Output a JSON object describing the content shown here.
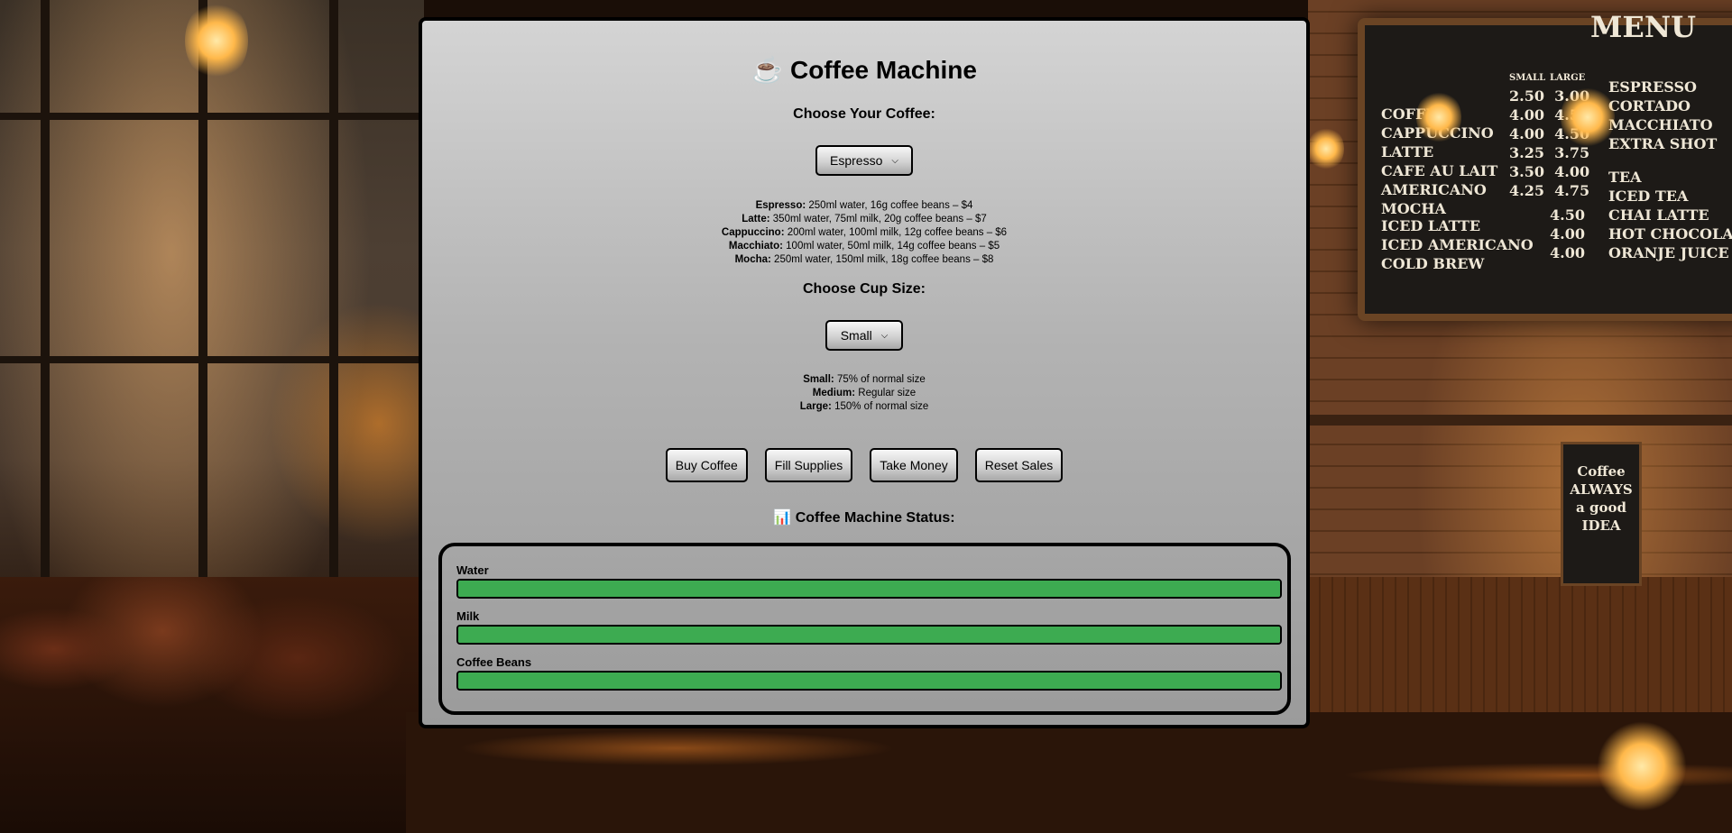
{
  "app": {
    "title": "Coffee Machine",
    "title_icon": "coffee-cup-icon",
    "title_glyph": "☕"
  },
  "coffee_select": {
    "heading": "Choose Your Coffee:",
    "selected": "Espresso"
  },
  "coffee_menu": [
    {
      "name": "Espresso:",
      "details": "250ml water, 16g coffee beans – $4"
    },
    {
      "name": "Latte:",
      "details": "350ml water, 75ml milk, 20g coffee beans – $7"
    },
    {
      "name": "Cappuccino:",
      "details": "200ml water, 100ml milk, 12g coffee beans – $6"
    },
    {
      "name": "Macchiato:",
      "details": "100ml water, 50ml milk, 14g coffee beans – $5"
    },
    {
      "name": "Mocha:",
      "details": "250ml water, 150ml milk, 18g coffee beans – $8"
    }
  ],
  "size_select": {
    "heading": "Choose Cup Size:",
    "selected": "Small"
  },
  "size_menu": [
    {
      "name": "Small:",
      "details": "75% of normal size"
    },
    {
      "name": "Medium:",
      "details": "Regular size"
    },
    {
      "name": "Large:",
      "details": "150% of normal size"
    }
  ],
  "actions": {
    "buy": "Buy Coffee",
    "fill": "Fill Supplies",
    "take": "Take Money",
    "reset": "Reset Sales"
  },
  "status": {
    "heading": "Coffee Machine Status:",
    "icon": "bar-chart-icon",
    "icon_glyph": "📊",
    "meters": [
      {
        "label": "Water",
        "level_percent": 100
      },
      {
        "label": "Milk",
        "level_percent": 100
      },
      {
        "label": "Coffee Beans",
        "level_percent": 100
      }
    ]
  },
  "background": {
    "menu_board": {
      "header": "MENU",
      "price_headers": [
        "SMALL",
        "LARGE"
      ],
      "left_items": [
        "COFFEE",
        "CAPPUCCINO",
        "LATTE",
        "CAFE AU LAIT",
        "AMERICANO",
        "MOCHA"
      ],
      "left_prices": [
        "2.50  3.00",
        "4.00  4.50",
        "4.00  4.50",
        "3.25  3.75",
        "3.50  4.00",
        "4.25  4.75"
      ],
      "right_items": [
        "ESPRESSO",
        "CORTADO",
        "MACCHIATO",
        "EXTRA SHOT",
        "",
        "TEA",
        "ICED TEA",
        "CHAI LATTE",
        "HOT CHOCOLATE",
        "ORANJE JUICE"
      ],
      "cold_items": [
        "ICED LATTE",
        "ICED AMERICANO",
        "COLD BREW"
      ],
      "cold_prices": [
        "4.50",
        "4.00",
        "4.00"
      ]
    },
    "sign": {
      "text": "Coffee ALWAYS a good IDEA"
    }
  },
  "colors": {
    "panel_top": "#d4d4d4",
    "panel_bottom": "#9b9b9b",
    "meter_fill": "#3dab51",
    "border": "#000000"
  }
}
